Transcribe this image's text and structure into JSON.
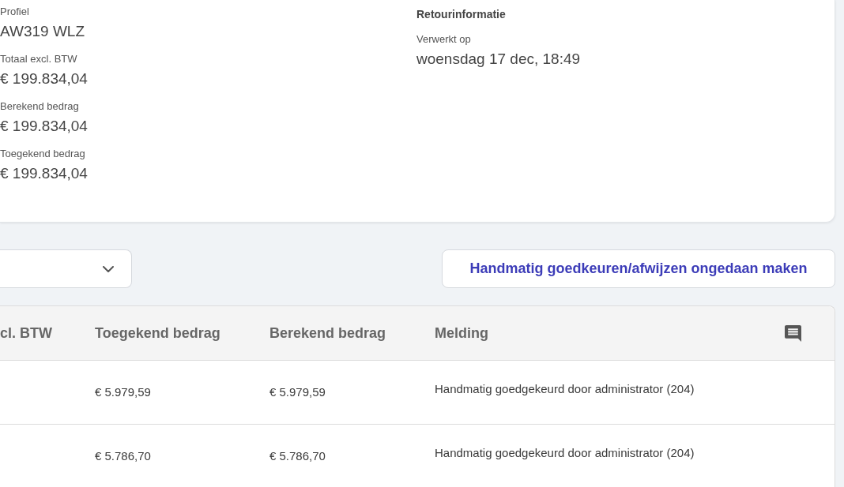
{
  "summary": {
    "fields": [
      {
        "label": "Profiel",
        "value": "AW319 WLZ"
      },
      {
        "label": "Totaal excl. BTW",
        "value": "€ 199.834,04"
      },
      {
        "label": "Berekend bedrag",
        "value": "€ 199.834,04"
      },
      {
        "label": "Toegekend bedrag",
        "value": "€ 199.834,04"
      }
    ]
  },
  "return_info": {
    "title": "Retourinformatie",
    "fields": [
      {
        "label": "Verwerkt op",
        "value": "woensdag 17 dec, 18:49"
      }
    ]
  },
  "filter_dropdown": {
    "expanded": false
  },
  "undo_button": {
    "label": "Handmatig goedkeuren/afwijzen ongedaan maken"
  },
  "table": {
    "columns": [
      "cl. BTW",
      "Toegekend bedrag",
      "Berekend bedrag",
      "Melding"
    ],
    "rows": [
      {
        "toegekend_bedrag": "€ 5.979,59",
        "berekend_bedrag": "€ 5.979,59",
        "melding": "Handmatig goedgekeurd door administrator (204)"
      },
      {
        "toegekend_bedrag": "€ 5.786,70",
        "berekend_bedrag": "€ 5.786,70",
        "melding": "Handmatig goedgekeurd door administrator (204)"
      }
    ]
  }
}
